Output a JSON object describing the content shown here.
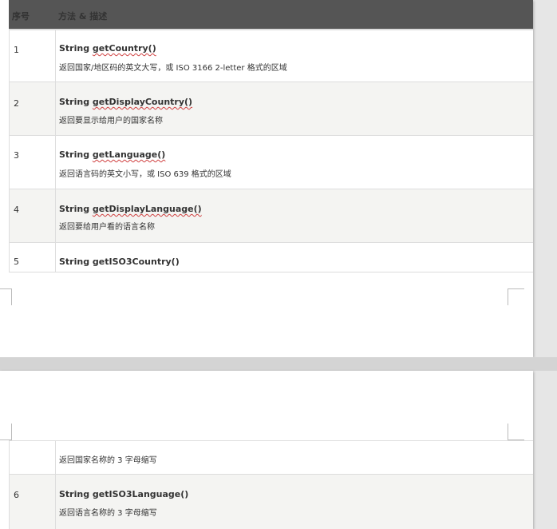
{
  "table": {
    "header": {
      "index": "序号",
      "method": "方法 & 描述"
    },
    "rows": [
      {
        "index": "1",
        "prefix": "String ",
        "name": "getCountry()",
        "desc": "返回国家/地区码的英文大写，或 ISO 3166 2-letter 格式的区域"
      },
      {
        "index": "2",
        "prefix": "String ",
        "name": "getDisplayCountry()",
        "desc": "返回要显示给用户的国家名称"
      },
      {
        "index": "3",
        "prefix": "String ",
        "name": "getLanguage()",
        "desc": "返回语言码的英文小写，或 ISO 639 格式的区域"
      },
      {
        "index": "4",
        "prefix": "String ",
        "name": "getDisplayLanguage()",
        "desc": "返回要给用户看的语言名称"
      },
      {
        "index": "5",
        "prefix": "String ",
        "name": "getISO3Country()",
        "desc": "返回国家名称的 3 字母缩写"
      },
      {
        "index": "6",
        "prefix": "String ",
        "name": "getISO3Language()",
        "desc": "返回语言名称的 3 字母缩写"
      }
    ]
  }
}
